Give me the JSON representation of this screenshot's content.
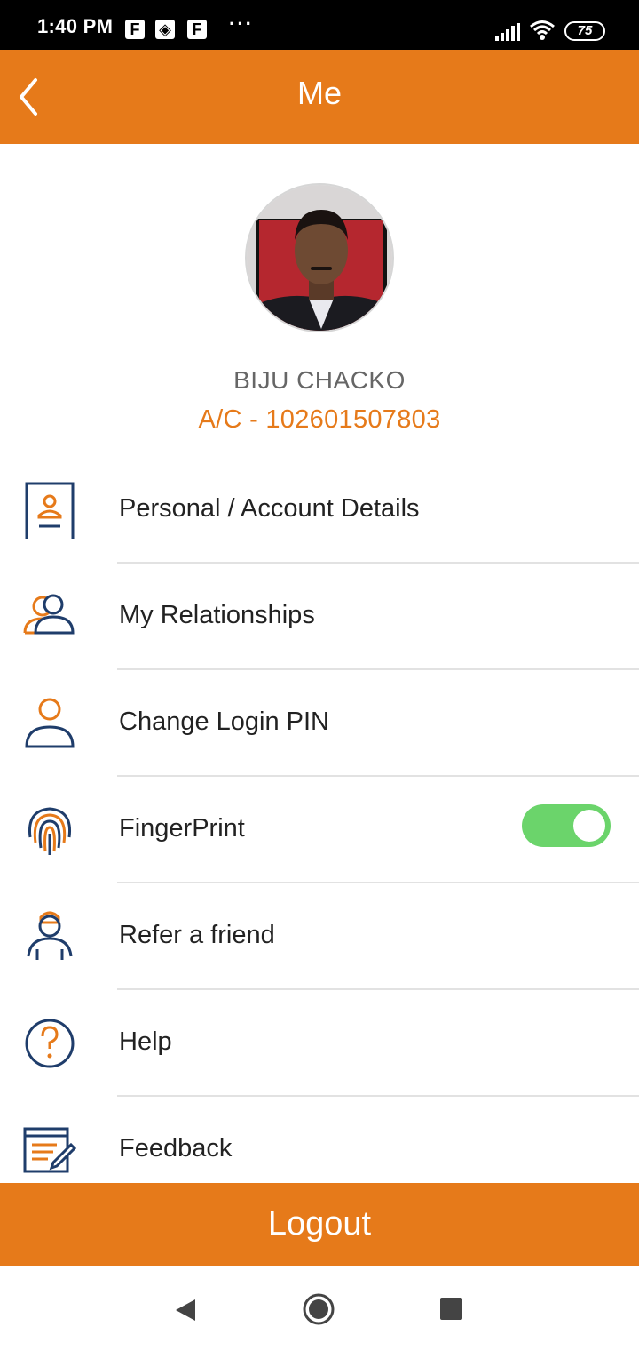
{
  "status_bar": {
    "time": "1:40 PM",
    "app_icons": [
      "F",
      "◈",
      "F"
    ],
    "more": "···",
    "battery": "75"
  },
  "app_bar": {
    "title": "Me",
    "back_icon": "chevron-left-icon"
  },
  "profile": {
    "name": "BIJU CHACKO",
    "account": "A/C - 102601507803"
  },
  "menu": {
    "items": [
      {
        "label": "Personal / Account Details",
        "icon": "id-card-icon"
      },
      {
        "label": "My Relationships",
        "icon": "users-icon"
      },
      {
        "label": "Change Login PIN",
        "icon": "user-icon"
      },
      {
        "label": "FingerPrint",
        "icon": "fingerprint-icon"
      },
      {
        "label": "Refer a friend",
        "icon": "person-icon"
      },
      {
        "label": "Help",
        "icon": "help-icon"
      },
      {
        "label": "Feedback",
        "icon": "feedback-icon"
      }
    ],
    "fingerprint_toggle_on": true
  },
  "logout_label": "Logout",
  "colors": {
    "accent": "#E67A1A",
    "icon_blue": "#1F3D6B",
    "toggle_on": "#6BD46B"
  }
}
